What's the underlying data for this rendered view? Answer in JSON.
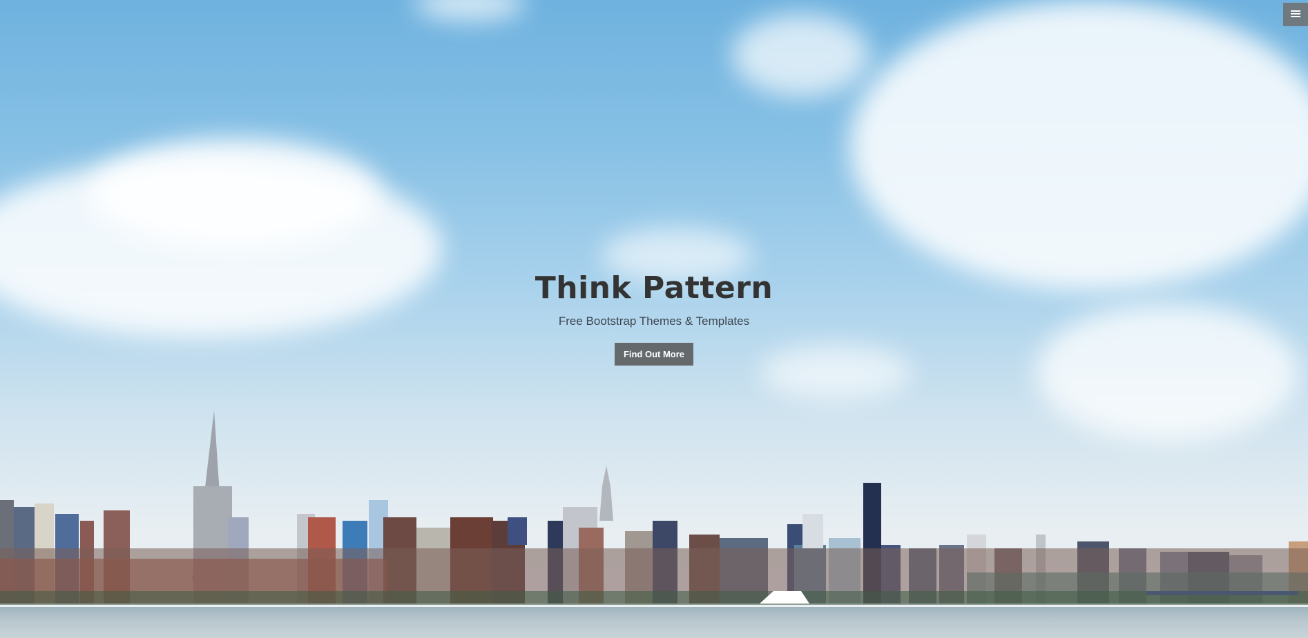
{
  "hero": {
    "title": "Think Pattern",
    "subtitle": "Free Bootstrap Themes & Templates",
    "cta_label": "Find Out More"
  },
  "menu_toggle": {
    "icon": "hamburger-icon"
  },
  "colors": {
    "title": "#333333",
    "button_bg": "#555555",
    "button_text": "#ffffff",
    "sky_top": "#6fb2df",
    "sky_bottom": "#eef1f3"
  }
}
